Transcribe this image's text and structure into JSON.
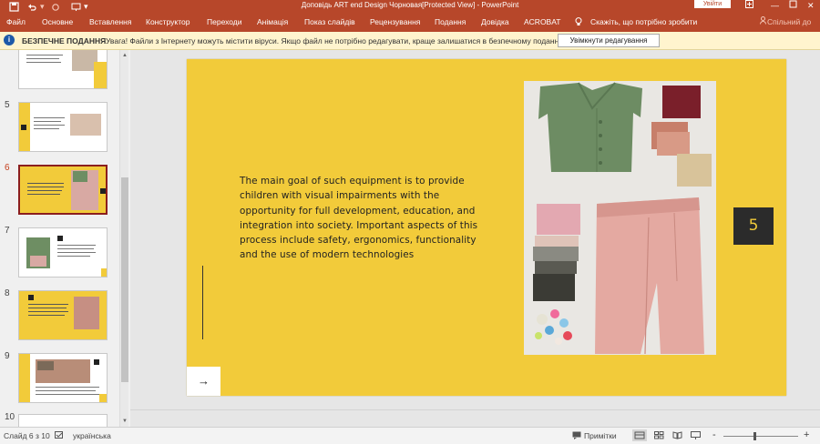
{
  "titlebar": {
    "title": "Доповідь ART end Design Чорновая[Protected View]  -  PowerPoint",
    "signin": "Увійти",
    "save_icon": "save-icon",
    "undo_icon": "undo-icon",
    "redo_icon": "redo-icon"
  },
  "ribbon": {
    "tabs": [
      "Файл",
      "Основне",
      "Вставлення",
      "Конструктор",
      "Переходи",
      "Анімація",
      "Показ слайдів",
      "Рецензування",
      "Подання",
      "Довідка",
      "ACROBAT"
    ],
    "tell_me": "Скажіть, що потрібно зробити",
    "share": "Спільний до"
  },
  "protected_view": {
    "title": "БЕЗПЕЧНЕ ПОДАННЯ",
    "message": "Увага! Файли з Інтернету можуть містити віруси. Якщо файл не потрібно редагувати, краще залишатися в безпечному поданні.",
    "button": "Увімкнути редагування"
  },
  "thumbnails": {
    "numbers": [
      "5",
      "6",
      "7",
      "8",
      "9",
      "10"
    ],
    "active": "6"
  },
  "slide": {
    "body": "The main goal of such equipment is to provide children with visual impairments with the opportunity for full development, education, and integration into society. Important aspects of this process include safety, ergonomics, functionality and the use of modern technologies",
    "number": "5",
    "arrow": "→"
  },
  "status": {
    "slide_info": "Слайд 6 з 10",
    "language": "українська",
    "notes": "Примітки",
    "zoom_minus": "-",
    "zoom_plus": "+"
  },
  "colors": {
    "brand": "#b7472a",
    "slide_bg": "#f2cb3a",
    "dark": "#2b2b2b",
    "active_thumb_border": "#8b1e1e"
  }
}
